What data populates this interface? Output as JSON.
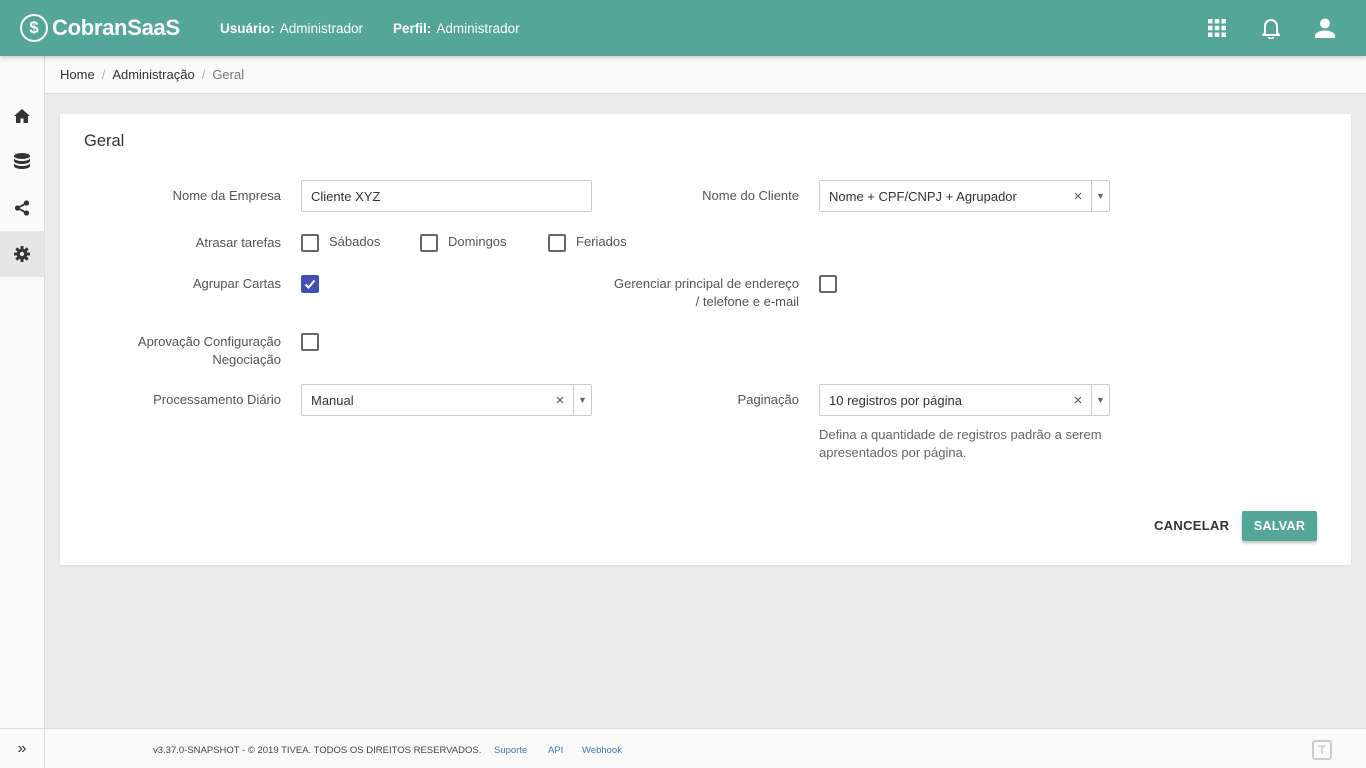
{
  "header": {
    "brand": "CobranSaaS",
    "brand_symbol": "$",
    "user_label": "Usuário:",
    "user_value": "Administrador",
    "profile_label": "Perfil:",
    "profile_value": "Administrador",
    "color": "#54a798",
    "icons": [
      "apps-grid-icon",
      "bell-icon",
      "user-icon"
    ]
  },
  "sidebar": {
    "items": [
      {
        "icon": "home-icon"
      },
      {
        "icon": "database-icon"
      },
      {
        "icon": "share-icon"
      },
      {
        "icon": "gear-icon",
        "active": true
      }
    ],
    "expand_label": "»"
  },
  "breadcrumb": {
    "items": [
      "Home",
      "Administração"
    ],
    "current": "Geral",
    "separator": "/"
  },
  "form": {
    "title": "Geral",
    "nome_empresa": {
      "label": "Nome da Empresa",
      "value": "Cliente XYZ"
    },
    "nome_cliente": {
      "label": "Nome do Cliente",
      "value": "Nome + CPF/CNPJ + Agrupador",
      "clear": "×",
      "arrow": "▼"
    },
    "atrasar_tarefas": {
      "label": "Atrasar tarefas",
      "options": [
        {
          "label": "Sábados",
          "checked": false
        },
        {
          "label": "Domingos",
          "checked": false
        },
        {
          "label": "Feriados",
          "checked": false
        }
      ]
    },
    "agrupar_cartas": {
      "label": "Agrupar Cartas",
      "checked": true
    },
    "gerenciar_principal": {
      "label_line1": "Gerenciar principal de endereço",
      "label_line2": "/ telefone e e-mail",
      "checked": false
    },
    "aprovacao_config": {
      "label_line1": "Aprovação Configuração",
      "label_line2": "Negociação",
      "checked": false
    },
    "processamento_diario": {
      "label": "Processamento Diário",
      "value": "Manual",
      "clear": "×",
      "arrow": "▼"
    },
    "paginacao": {
      "label": "Paginação",
      "value": "10 registros por página",
      "clear": "×",
      "arrow": "▼",
      "helper_line1": "Defina a quantidade de registros padrão a serem",
      "helper_line2": "apresentados por página."
    },
    "cancel_label": "CANCELAR",
    "save_label": "SALVAR",
    "checkbox_color": "#3f51b5"
  },
  "footer": {
    "version": "v3.37.0-SNAPSHOT - © 2019 TIVEA. TODOS OS DIREITOS RESERVADOS.",
    "links": [
      "Suporte",
      "API",
      "Webhook"
    ],
    "logo_char": "T"
  }
}
